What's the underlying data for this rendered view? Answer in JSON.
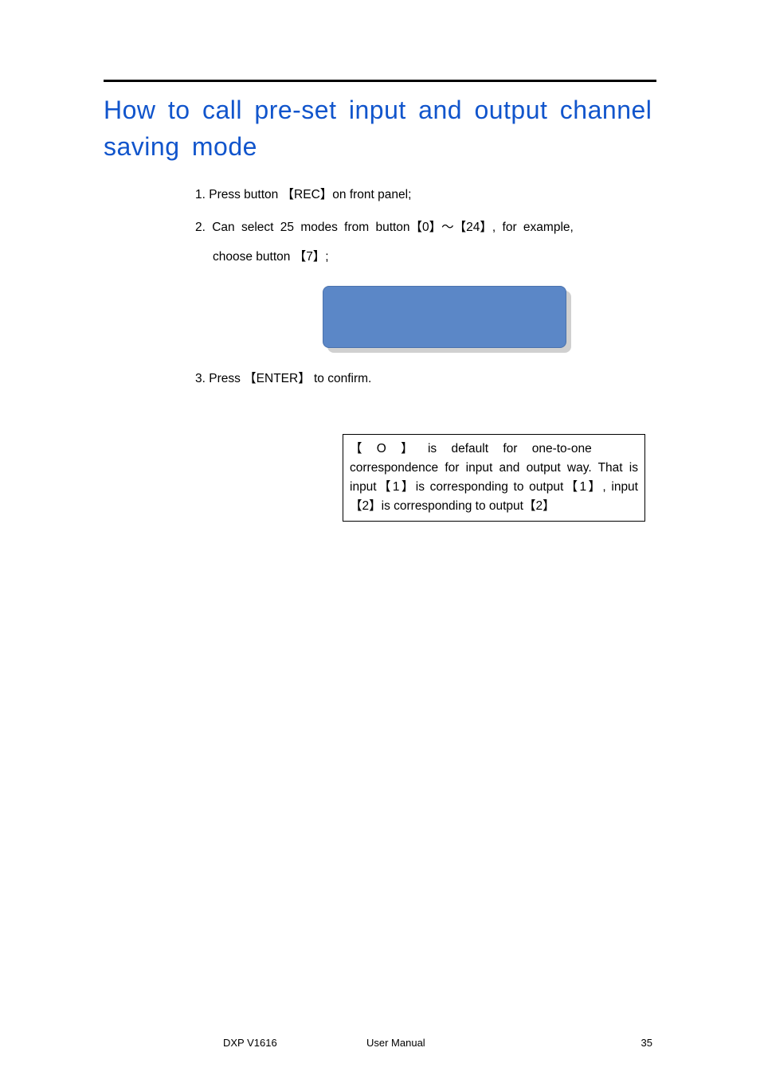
{
  "heading": "How to call pre-set input and output channel saving mode",
  "steps": {
    "s1": "1. Press button 【REC】on front panel;",
    "s2a": "2. Can select 25 modes from button【0】～【24】, for example,",
    "s2b": "choose button 【7】;",
    "s3": "3. Press 【ENTER】 to confirm."
  },
  "note": {
    "l1": "【 O 】 is default for one-to-one",
    "l2": "correspondence for input and output way. That is input【1】is corresponding to output【1】, input【2】is corresponding to output【2】"
  },
  "footer": {
    "left": "DXP V1616",
    "center": "User Manual",
    "right": "35"
  }
}
